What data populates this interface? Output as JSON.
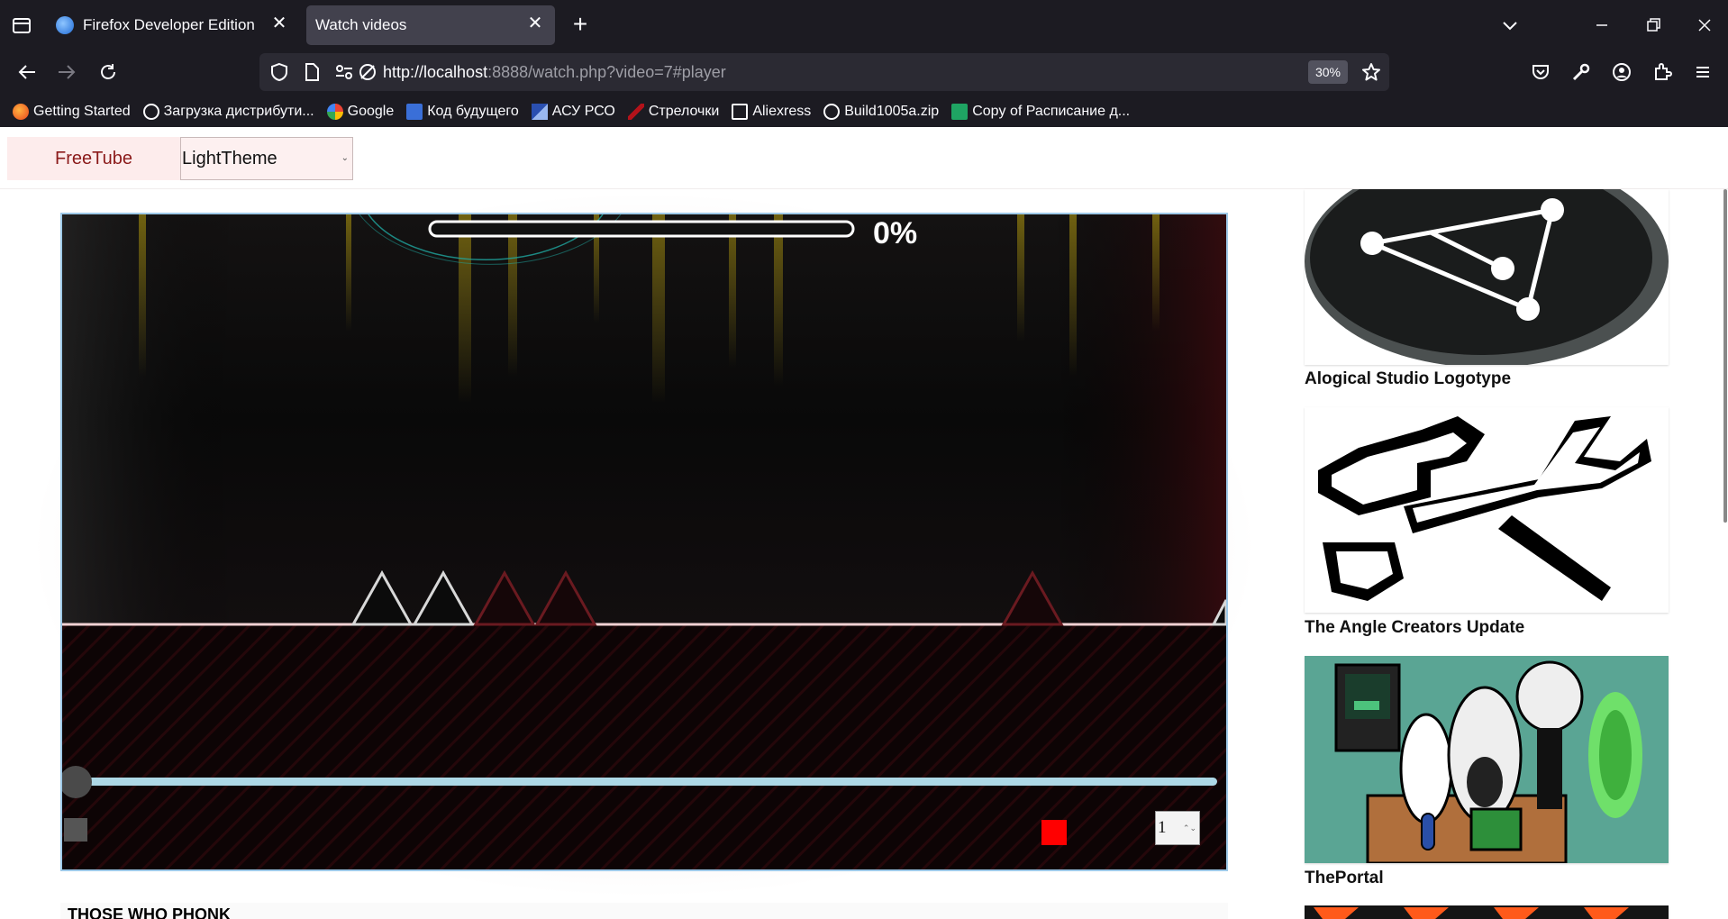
{
  "browser": {
    "tabs": [
      {
        "title": "Firefox Developer Edition",
        "active": false
      },
      {
        "title": "Watch videos",
        "active": true
      }
    ],
    "url_host": "http://localhost",
    "url_rest": ":8888/watch.php?video=7#player",
    "zoom": "30%",
    "bookmarks": [
      {
        "label": "Getting Started",
        "icon": "firefox-icon"
      },
      {
        "label": "Загрузка дистрибути...",
        "icon": "globe-icon"
      },
      {
        "label": "Google",
        "icon": "google-icon"
      },
      {
        "label": "Код будущего",
        "icon": "code-icon"
      },
      {
        "label": "АСУ РСО",
        "icon": "asu-icon"
      },
      {
        "label": "Стрелочки",
        "icon": "arrow-icon"
      },
      {
        "label": "Aliexress",
        "icon": "folder-icon"
      },
      {
        "label": "Build1005a.zip",
        "icon": "globe-icon"
      },
      {
        "label": "Copy of Расписание д...",
        "icon": "sheets-icon"
      }
    ]
  },
  "site": {
    "brand": "FreeTube",
    "theme_select": "LightTheme"
  },
  "player": {
    "progress_label": "0%",
    "seek_position": 0,
    "speed_value": "1",
    "accent": "#add8e6",
    "stop_color": "#ff0000"
  },
  "video": {
    "title": "THOSE WHO PHONK"
  },
  "sidebar": {
    "items": [
      {
        "title": "Alogical Studio Logotype"
      },
      {
        "title": "The Angle Creators Update"
      },
      {
        "title": "ThePortal"
      }
    ]
  }
}
